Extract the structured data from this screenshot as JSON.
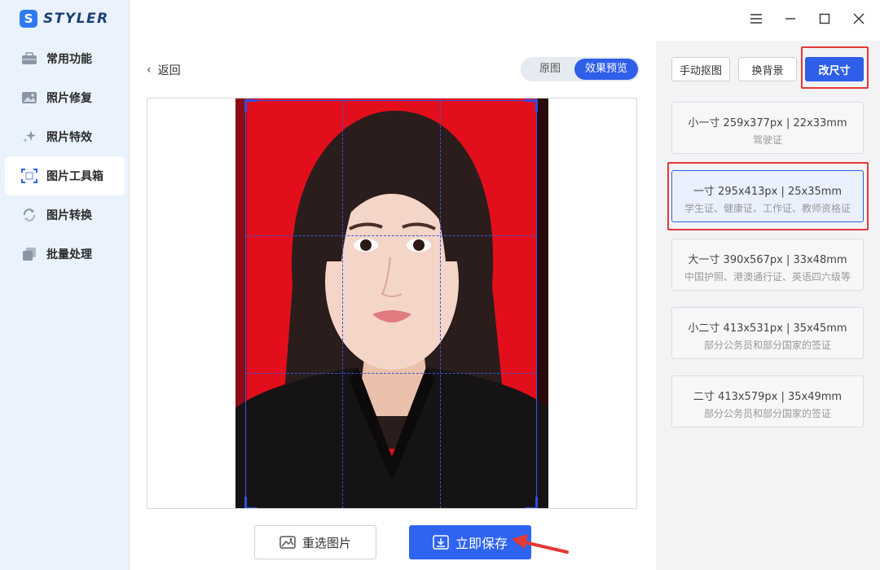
{
  "app": {
    "name": "STYLER",
    "logo_letter": "S"
  },
  "sidebar": {
    "items": [
      {
        "label": "常用功能",
        "icon": "toolbox-icon"
      },
      {
        "label": "照片修复",
        "icon": "image-repair-icon"
      },
      {
        "label": "照片特效",
        "icon": "sparkle-icon"
      },
      {
        "label": "图片工具箱",
        "icon": "crop-frame-icon",
        "active": true
      },
      {
        "label": "图片转换",
        "icon": "convert-icon"
      },
      {
        "label": "批量处理",
        "icon": "batch-icon"
      }
    ]
  },
  "main": {
    "back_label": "返回",
    "view_toggle": {
      "original": "原图",
      "preview": "效果预览",
      "selected": "效果预览"
    },
    "buttons": {
      "reselect": "重选图片",
      "save": "立即保存"
    }
  },
  "right_panel": {
    "tools": [
      {
        "label": "手动抠图"
      },
      {
        "label": "换背景"
      },
      {
        "label": "改尺寸",
        "active": true
      }
    ],
    "sizes": [
      {
        "title": "小一寸 259x377px | 22x33mm",
        "sub": "驾驶证"
      },
      {
        "title": "一寸 295x413px | 25x35mm",
        "sub": "学生证、健康证、工作证、教师资格证",
        "selected": true
      },
      {
        "title": "大一寸 390x567px | 33x48mm",
        "sub": "中国护照、港澳通行证、英语四六级等"
      },
      {
        "title": "小二寸 413x531px | 35x45mm",
        "sub": "部分公务员和部分国家的签证"
      },
      {
        "title": "二寸 413x579px | 35x49mm",
        "sub": "部分公务员和部分国家的签证"
      }
    ]
  },
  "colors": {
    "accent": "#2f5fe8",
    "photo_background": "#e30e1b",
    "highlight": "#e53935"
  }
}
